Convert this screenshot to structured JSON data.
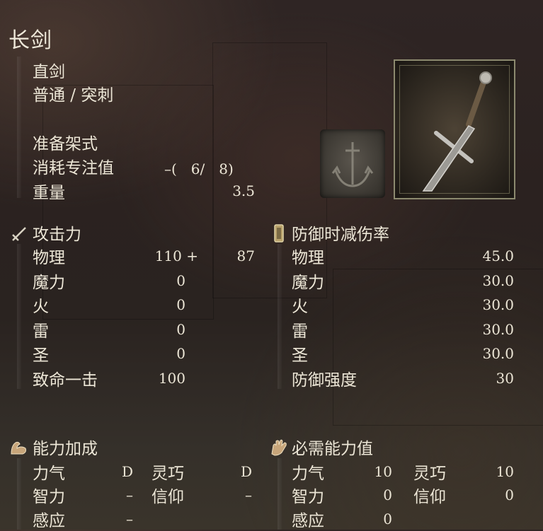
{
  "item": {
    "name": "长剑",
    "type": "直剑",
    "attack_type": "普通 / 突刺",
    "skill_name": "准备架式",
    "fp_label": "消耗专注值",
    "fp_cost": "–(　6/　8)",
    "weight_label": "重量",
    "weight": "3.5"
  },
  "attack": {
    "header": "攻击力",
    "rows": [
      {
        "label": "物理",
        "base": "110 +",
        "bonus": "87"
      },
      {
        "label": "魔力",
        "base": "0",
        "bonus": ""
      },
      {
        "label": "火",
        "base": "0",
        "bonus": ""
      },
      {
        "label": "雷",
        "base": "0",
        "bonus": ""
      },
      {
        "label": "圣",
        "base": "0",
        "bonus": ""
      },
      {
        "label": "致命一击",
        "base": "100",
        "bonus": ""
      }
    ]
  },
  "guard": {
    "header": "防御时减伤率",
    "rows": [
      {
        "label": "物理",
        "value": "45.0"
      },
      {
        "label": "魔力",
        "value": "30.0"
      },
      {
        "label": "火",
        "value": "30.0"
      },
      {
        "label": "雷",
        "value": "30.0"
      },
      {
        "label": "圣",
        "value": "30.0"
      },
      {
        "label": "防御强度",
        "value": "30"
      }
    ]
  },
  "scaling": {
    "header": "能力加成",
    "rows": [
      {
        "label": "力气",
        "value": "D",
        "label2": "灵巧",
        "value2": "D"
      },
      {
        "label": "智力",
        "value": "–",
        "label2": "信仰",
        "value2": "–"
      },
      {
        "label": "感应",
        "value": "–"
      }
    ]
  },
  "requirements": {
    "header": "必需能力值",
    "rows": [
      {
        "label": "力气",
        "value": "10",
        "label2": "灵巧",
        "value2": "10"
      },
      {
        "label": "智力",
        "value": "0",
        "label2": "信仰",
        "value2": "0"
      },
      {
        "label": "感应",
        "value": "0"
      }
    ]
  },
  "icons": {
    "attack": "sword-icon",
    "guard": "shield-icon",
    "scaling": "arm-flex-icon",
    "requirements": "hand-icon",
    "skill": "anchor-sword-emblem-icon",
    "weapon": "longsword-icon"
  }
}
